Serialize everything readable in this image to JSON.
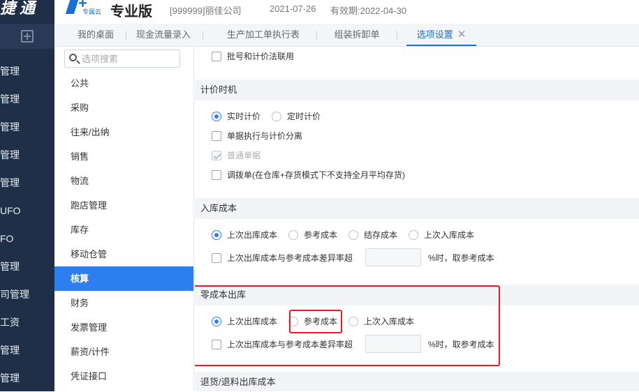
{
  "header": {
    "brand": "捷通",
    "logo_sub": "专属云",
    "edition": "专业版",
    "company": "[999999]丽佳公司",
    "date": "2021-07-26",
    "validity": "有效期:2022-04-30"
  },
  "left_nav": {
    "items": [
      {
        "label": "管理"
      },
      {
        "label": "管理"
      },
      {
        "label": "管理"
      },
      {
        "label": "管理"
      },
      {
        "label": "管理"
      },
      {
        "label": "UFO"
      },
      {
        "label": "FO"
      },
      {
        "label": "管理"
      },
      {
        "label": "司管理"
      },
      {
        "label": "工资"
      },
      {
        "label": "管理"
      },
      {
        "label": "管理"
      }
    ]
  },
  "tabs": [
    {
      "label": "我的桌面"
    },
    {
      "label": "现金流量录入"
    },
    {
      "label": "生产加工单执行表"
    },
    {
      "label": "组装拆卸单"
    },
    {
      "label": "选项设置",
      "active": true,
      "close": "✕"
    }
  ],
  "menu": {
    "search_placeholder": "选项搜索",
    "items": [
      {
        "label": "公共"
      },
      {
        "label": "采购"
      },
      {
        "label": "往来/出纳"
      },
      {
        "label": "销售"
      },
      {
        "label": "物流"
      },
      {
        "label": "跑店管理"
      },
      {
        "label": "库存"
      },
      {
        "label": "移动仓管"
      },
      {
        "label": "核算",
        "active": true
      },
      {
        "label": "财务"
      },
      {
        "label": "发票管理"
      },
      {
        "label": "薪资/计件"
      },
      {
        "label": "凭证接口"
      }
    ]
  },
  "content": {
    "top_checkbox": "批号和计价法联用",
    "pricing": {
      "title": "计价时机",
      "radios": [
        "实时计价",
        "定时计价"
      ],
      "selected": 0,
      "checkboxes": [
        {
          "label": "单据执行与计价分离",
          "checked": false,
          "disabled": false
        },
        {
          "label": "普通单据",
          "checked": true,
          "disabled": true
        },
        {
          "label": "调拨单(在仓库+存货模式下不支持全月平均存货)",
          "checked": false,
          "disabled": false
        }
      ]
    },
    "inbound": {
      "title": "入库成本",
      "radios": [
        "上次出库成本",
        "参考成本",
        "结存成本",
        "上次入库成本"
      ],
      "selected": 0,
      "diff_label": "上次出库成本与参考成本差异率超",
      "diff_value": "",
      "diff_suffix": "%时，取参考成本"
    },
    "zero_cost": {
      "title": "零成本出库",
      "radios": [
        "上次出库成本",
        "参考成本",
        "上次入库成本"
      ],
      "selected": 0,
      "diff_label": "上次出库成本与参考成本差异率超",
      "diff_value": "",
      "diff_suffix": "%时，取参考成本"
    },
    "return": {
      "title": "退货/退料出库成本"
    }
  },
  "colors": {
    "sidebar": "#1f2f47",
    "accent": "#2d7ff0",
    "highlight": "#e02020"
  }
}
